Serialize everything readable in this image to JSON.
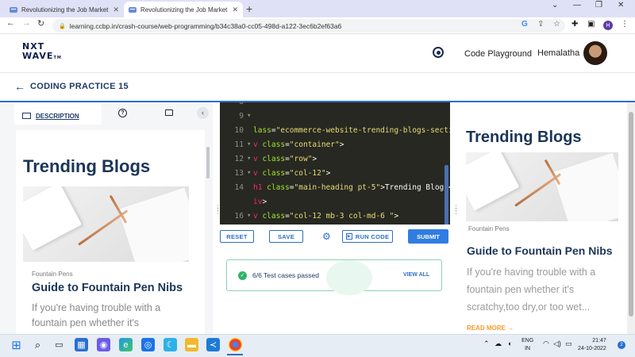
{
  "browser": {
    "tabs": [
      {
        "title": "Revolutionizing the Job Market |",
        "close": "✕"
      },
      {
        "title": "Revolutionizing the Job Market |",
        "close": "✕"
      }
    ],
    "new_tab": "+",
    "window_controls": [
      "⌄",
      "—",
      "❐",
      "✕"
    ],
    "url": "learning.ccbp.in/crash-course/web-programming/b34c38a0-cc05-498d-a122-3ec6b2ef63a6",
    "profile_initial": "H"
  },
  "header": {
    "logo_line1": "NXT",
    "logo_line2": "WAVE",
    "logo_tm": "TM",
    "code_playground": "Code Playground",
    "username": "Hemalatha"
  },
  "page": {
    "title": "CODING PRACTICE 15"
  },
  "left_panel": {
    "tab_description": "DESCRIPTION",
    "collapse": "‹",
    "preview": {
      "heading": "Trending Blogs",
      "category": "Fountain Pens",
      "card_title": "Guide to Fountain Pen Nibs",
      "card_desc": "If you're having trouble with a fountain pen whether it's"
    }
  },
  "editor": {
    "lines": [
      {
        "num": "8",
        "arrow": "",
        "code": [
          {
            "t": "",
            "c": "tx"
          }
        ]
      },
      {
        "num": "9",
        "arrow": "▾",
        "code": [
          {
            "t": "",
            "c": "tx"
          }
        ]
      },
      {
        "num": "10",
        "arrow": "",
        "code": [
          {
            "t": "lass",
            "c": "at"
          },
          {
            "t": "=",
            "c": "tx"
          },
          {
            "t": "\"ecommerce-website-trending-blogs-sectio",
            "c": "st"
          }
        ]
      },
      {
        "num": "11",
        "arrow": "▾",
        "code": [
          {
            "t": "v ",
            "c": "kw"
          },
          {
            "t": "class",
            "c": "at"
          },
          {
            "t": "=",
            "c": "tx"
          },
          {
            "t": "\"container\"",
            "c": "st"
          },
          {
            "t": ">",
            "c": "tx"
          }
        ]
      },
      {
        "num": "12",
        "arrow": "▾",
        "code": [
          {
            "t": "v ",
            "c": "kw"
          },
          {
            "t": "class",
            "c": "at"
          },
          {
            "t": "=",
            "c": "tx"
          },
          {
            "t": "\"row\"",
            "c": "st"
          },
          {
            "t": ">",
            "c": "tx"
          }
        ]
      },
      {
        "num": "13",
        "arrow": "▾",
        "code": [
          {
            "t": "v ",
            "c": "kw"
          },
          {
            "t": "class",
            "c": "at"
          },
          {
            "t": "=",
            "c": "tx"
          },
          {
            "t": "\"col-12\"",
            "c": "st"
          },
          {
            "t": ">",
            "c": "tx"
          }
        ]
      },
      {
        "num": "14",
        "arrow": "",
        "code": [
          {
            "t": "h1 ",
            "c": "kw"
          },
          {
            "t": "class",
            "c": "at"
          },
          {
            "t": "=",
            "c": "tx"
          },
          {
            "t": "\"main-heading pt-5\"",
            "c": "st"
          },
          {
            "t": ">Trending Blogs</",
            "c": "tx"
          }
        ]
      },
      {
        "num": "",
        "arrow": "",
        "code": [
          {
            "t": "iv",
            "c": "kw"
          },
          {
            "t": ">",
            "c": "tx"
          }
        ]
      },
      {
        "num": "16",
        "arrow": "▾",
        "code": [
          {
            "t": "v ",
            "c": "kw"
          },
          {
            "t": "class",
            "c": "at"
          },
          {
            "t": "=",
            "c": "tx"
          },
          {
            "t": "\"col-12 mb-3 col-md-6 \"",
            "c": "st"
          },
          {
            "t": ">",
            "c": "tx"
          }
        ]
      }
    ]
  },
  "controls": {
    "reset": "RESET",
    "save": "SAVE",
    "run": "RUN CODE",
    "submit": "SUBMIT"
  },
  "result": {
    "text": "6/6 Test cases passed",
    "view_all": "VIEW ALL"
  },
  "right_panel": {
    "heading": "Trending Blogs",
    "category": "Fountain Pens",
    "card_title": "Guide to Fountain Pen Nibs",
    "card_desc": "If you're having trouble with a fountain pen whether it's scratchy,too dry,or too wet...",
    "read_more": "READ MORE →"
  },
  "taskbar": {
    "lang1": "ENG",
    "lang2": "IN",
    "time": "21:47",
    "date": "24-10-2022",
    "notifications": "2"
  },
  "colors": {
    "accent": "#2d6fc7",
    "editor_bg": "#272822",
    "heading": "#1b3558",
    "success": "#2fb36b",
    "read_more": "#f39c2e"
  }
}
